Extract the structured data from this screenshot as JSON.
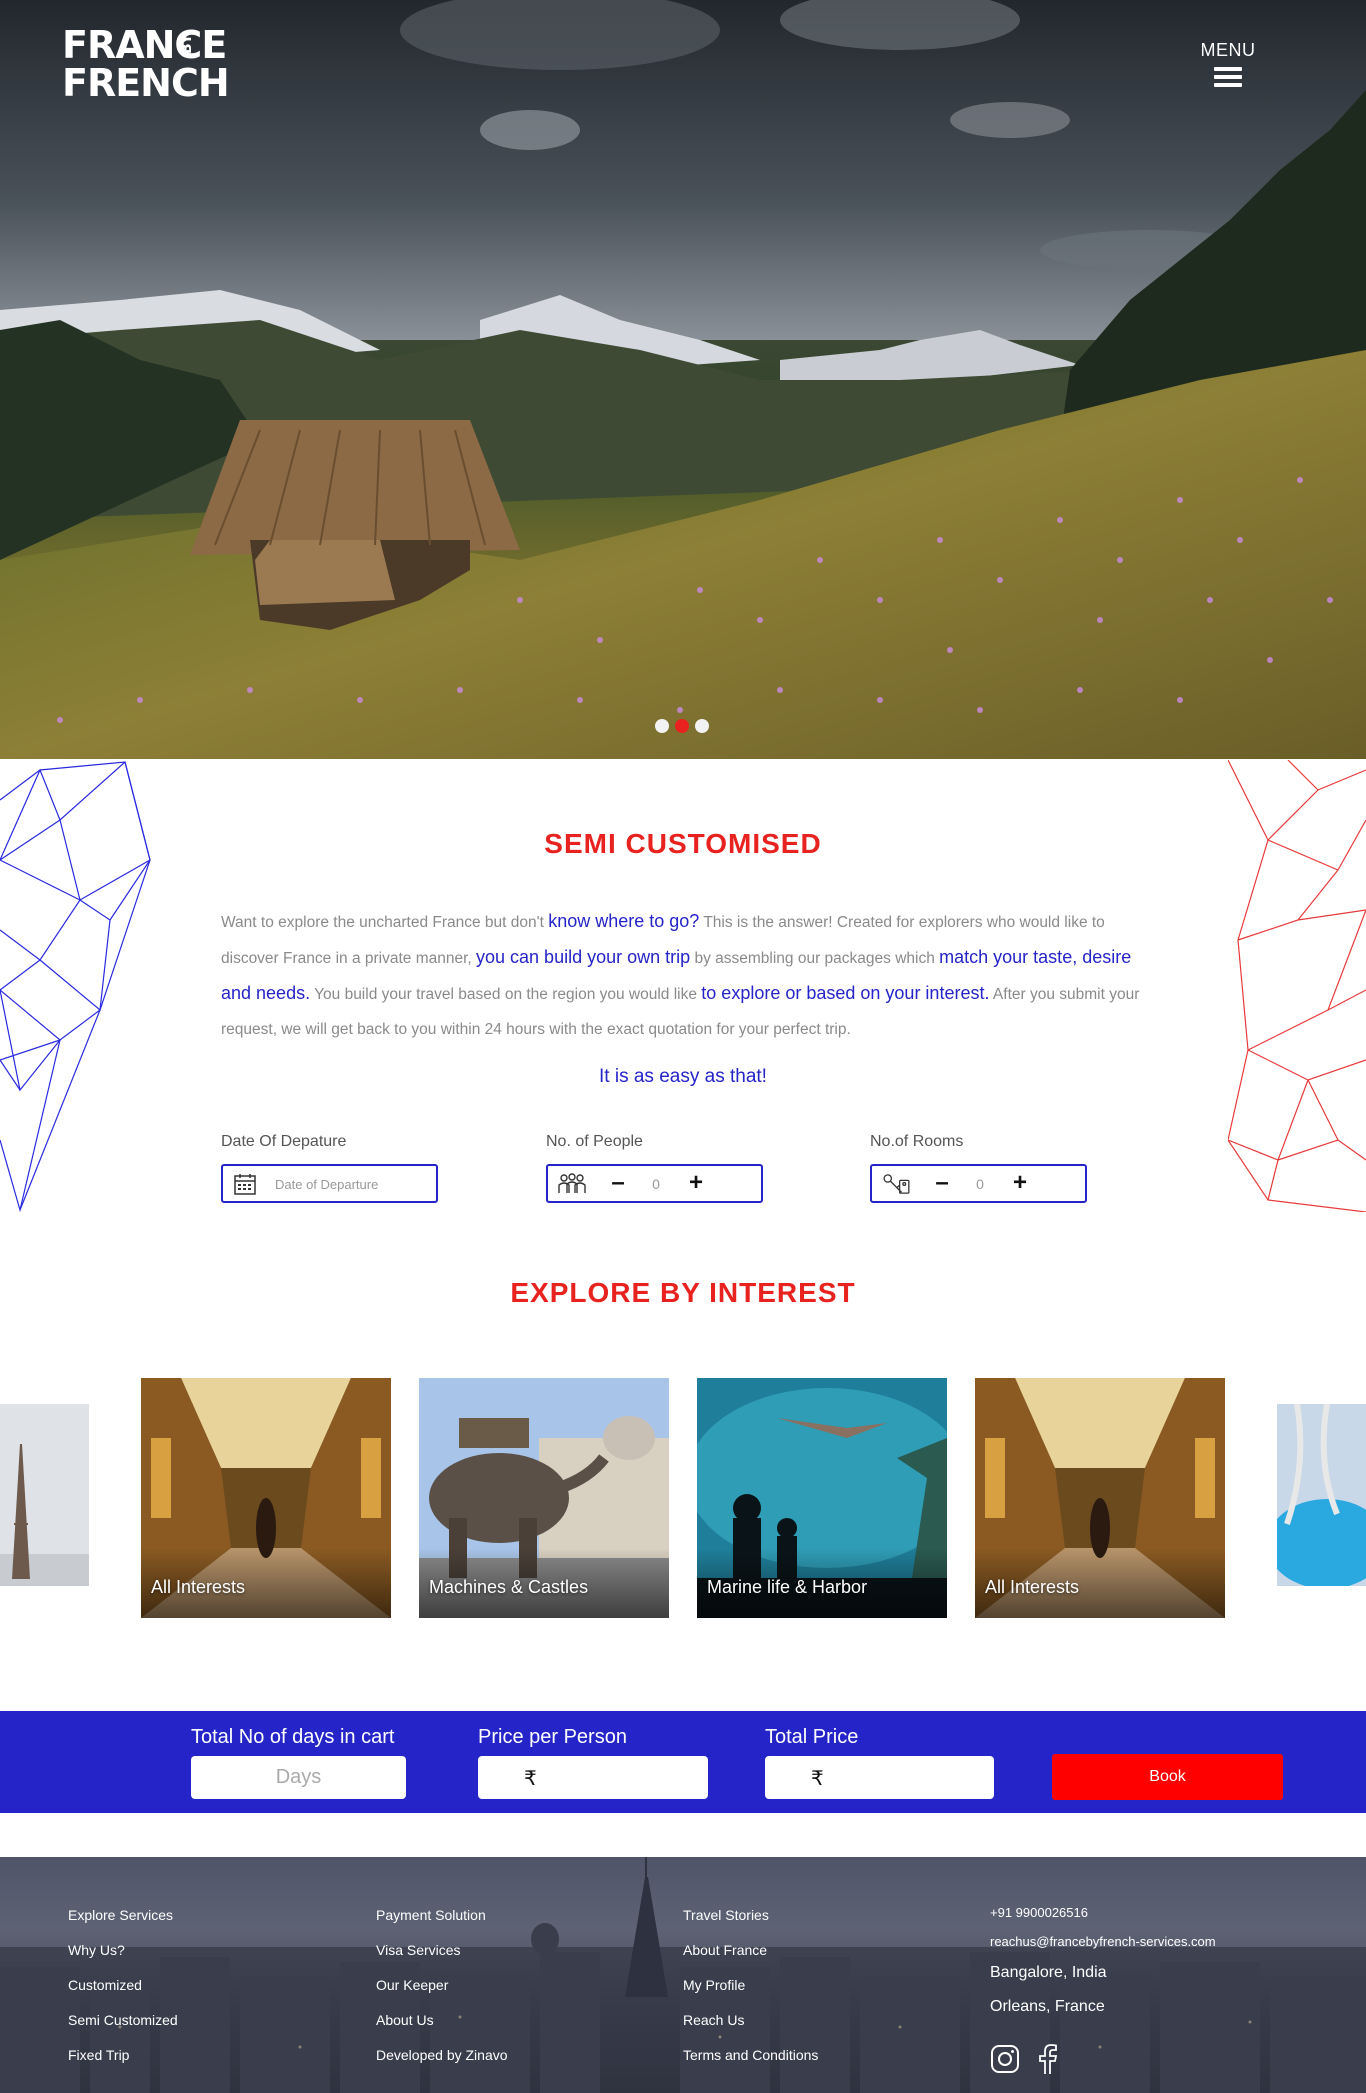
{
  "header": {
    "logo_line1": "FRANCE",
    "logo_line2": "FRENCH",
    "logo_by": "BY",
    "menu_label": "MENU"
  },
  "slider": {
    "dot_count": 3,
    "active_index": 1
  },
  "semi": {
    "title": "SEMI CUSTOMISED",
    "intro": [
      {
        "t": "Want to explore the uncharted France but don't ",
        "hl": false
      },
      {
        "t": "know where to go?",
        "hl": true
      },
      {
        "t": " This is the answer! Created for explorers who would like to discover France in a private manner, ",
        "hl": false
      },
      {
        "t": "you can build your own trip",
        "hl": true
      },
      {
        "t": " by assembling our packages which ",
        "hl": false
      },
      {
        "t": "match your taste, desire and needs.",
        "hl": true
      },
      {
        "t": " You build your travel based on the region you would like ",
        "hl": false
      },
      {
        "t": "to explore or based on your interest.",
        "hl": true
      },
      {
        "t": " After you submit your request, we will get back to you within 24 hours with the exact quotation for your perfect trip.",
        "hl": false
      }
    ],
    "easy": "It is as easy as that!",
    "departure_label": "Date Of Depature",
    "departure_placeholder": "Date of Departure",
    "people_label": "No. of People",
    "people_value": "0",
    "rooms_label": "No.of Rooms",
    "rooms_value": "0",
    "minus": "–",
    "plus": "+"
  },
  "explore": {
    "title": "EXPLORE BY INTEREST",
    "cards": [
      {
        "label": "All Interests"
      },
      {
        "label": "Machines & Castles"
      },
      {
        "label": "Marine life & Harbor"
      },
      {
        "label": "All Interests"
      }
    ]
  },
  "cart": {
    "days_label": "Total No of days in cart",
    "days_placeholder": "Days",
    "price_person_label": "Price per Person",
    "total_price_label": "Total Price",
    "currency": "₹",
    "book_label": "Book"
  },
  "footer": {
    "col1": [
      "Explore Services",
      "Why Us?",
      "Customized",
      "Semi Customized",
      "Fixed Trip"
    ],
    "col2": [
      "Payment Solution",
      "Visa Services",
      "Our Keeper",
      "About Us",
      "Developed by Zinavo"
    ],
    "col3": [
      "Travel Stories",
      "About France",
      "My Profile",
      "Reach Us",
      "Terms and Conditions"
    ],
    "phone": "+91 9900026516",
    "email": "reachus@francebyfrench-services.com",
    "city1": "Bangalore, India",
    "city2": "Orleans, France"
  },
  "colors": {
    "accent_red": "#e8221f",
    "brand_blue": "#2424c8",
    "book_red": "#ff0000"
  },
  "icons": [
    "hamburger-icon",
    "calendar-icon",
    "people-icon",
    "room-key-icon",
    "instagram-icon",
    "facebook-icon"
  ]
}
